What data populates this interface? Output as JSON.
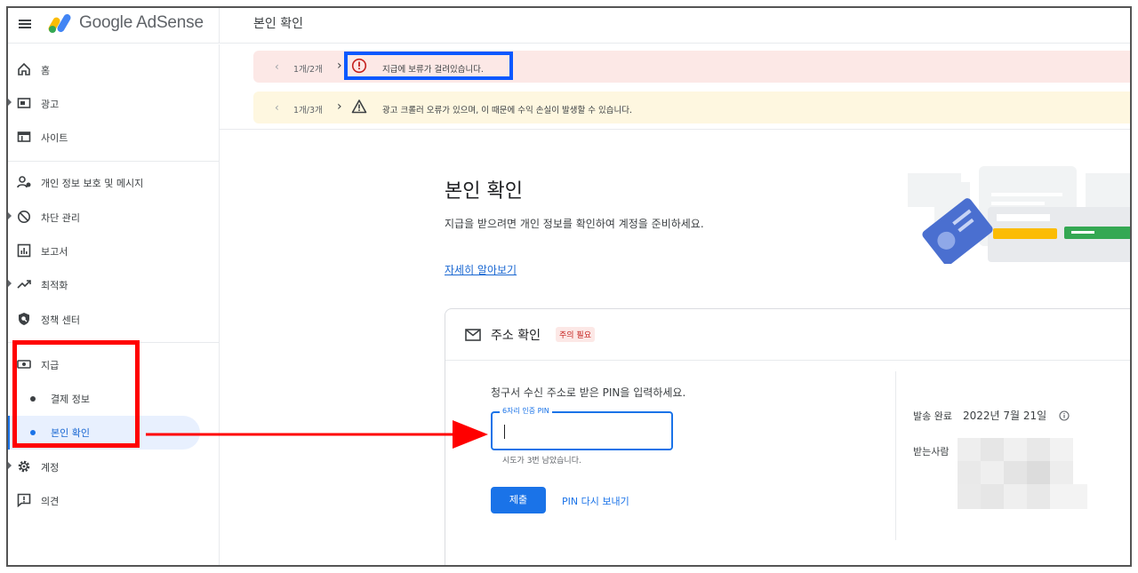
{
  "header": {
    "logo_text": "Google AdSense",
    "page_title": "본인 확인"
  },
  "sidebar": {
    "items": [
      {
        "label": "홈",
        "icon": "home-icon"
      },
      {
        "label": "광고",
        "icon": "ads-icon"
      },
      {
        "label": "사이트",
        "icon": "sites-icon"
      },
      {
        "label": "개인 정보 보호 및 메시지",
        "icon": "privacy-icon"
      },
      {
        "label": "차단 관리",
        "icon": "block-icon"
      },
      {
        "label": "보고서",
        "icon": "reports-icon"
      },
      {
        "label": "최적화",
        "icon": "optimization-icon"
      },
      {
        "label": "정책 센터",
        "icon": "policy-icon"
      },
      {
        "label": "지급",
        "icon": "payments-icon"
      },
      {
        "label": "계정",
        "icon": "gear-icon"
      },
      {
        "label": "의견",
        "icon": "feedback-icon"
      }
    ],
    "payments_subitems": [
      {
        "label": "결제 정보"
      },
      {
        "label": "본인 확인",
        "active": true
      }
    ]
  },
  "banners": {
    "error": {
      "count": "1개/2개",
      "message": "지급에 보류가 걸려있습니다."
    },
    "warning": {
      "count": "1개/3개",
      "message": "광고 크롤러 오류가 있으며, 이 때문에 수익 손실이 발생할 수 있습니다."
    }
  },
  "main": {
    "heading": "본인 확인",
    "description": "지급을 받으려면 개인 정보를 확인하여 계정을 준비하세요.",
    "learn_more": "자세히 알아보기"
  },
  "card": {
    "title": "주소 확인",
    "attention_chip": "주의 필요",
    "instruction": "청구서 수신 주소로 받은 PIN을 입력하세요.",
    "pin_label": "6자리 인증 PIN",
    "pin_value": "",
    "helper_text": "시도가 3번 남았습니다.",
    "submit_label": "제출",
    "resend_label": "PIN 다시 보내기",
    "sent_label": "발송 완료",
    "sent_date": "2022년 7월 21일",
    "recipient_label": "받는사람"
  },
  "colors": {
    "accent": "#1a73e8",
    "error_banner": "#fce8e6",
    "warning_banner": "#fef7e0",
    "annotation_red": "#ff0000",
    "annotation_blue": "#0a58ff"
  }
}
